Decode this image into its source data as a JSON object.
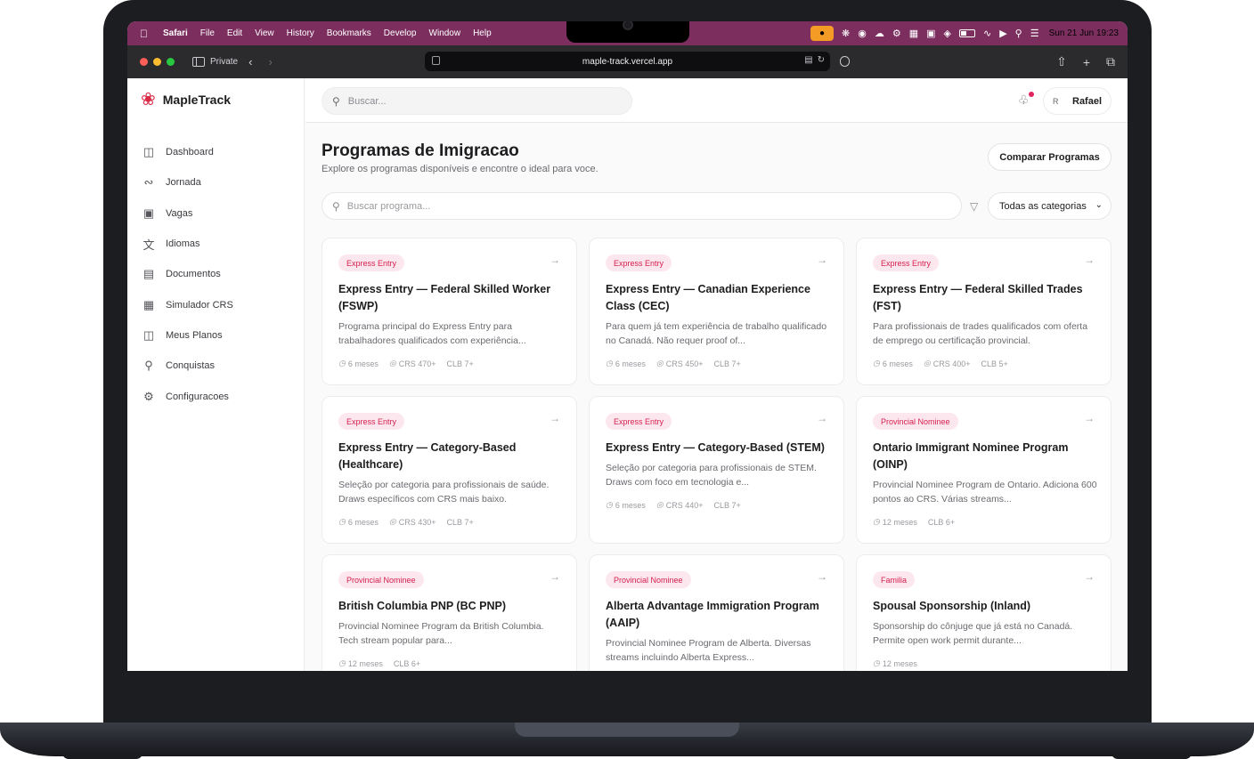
{
  "menubar": {
    "items": [
      "Safari",
      "File",
      "Edit",
      "View",
      "History",
      "Bookmarks",
      "Develop",
      "Window",
      "Help"
    ],
    "clock": "Sun 21 Jun  19:23"
  },
  "safari": {
    "private_label": "Private",
    "url": "maple-track.vercel.app"
  },
  "brand": {
    "name": "MapleTrack"
  },
  "sidebar": {
    "items": [
      {
        "label": "Dashboard",
        "icon": "dashboard-icon"
      },
      {
        "label": "Jornada",
        "icon": "route-icon"
      },
      {
        "label": "Vagas",
        "icon": "briefcase-icon"
      },
      {
        "label": "Idiomas",
        "icon": "translate-icon"
      },
      {
        "label": "Documentos",
        "icon": "document-icon"
      },
      {
        "label": "Simulador CRS",
        "icon": "calculator-icon"
      },
      {
        "label": "Meus Planos",
        "icon": "map-icon"
      },
      {
        "label": "Conquistas",
        "icon": "trophy-icon"
      },
      {
        "label": "Configuracoes",
        "icon": "settings-icon"
      }
    ]
  },
  "topbar": {
    "search_placeholder": "Buscar...",
    "avatar_initial": "R",
    "user_name": "Rafael"
  },
  "page": {
    "title": "Programas de Imigracao",
    "subtitle": "Explore os programas disponíveis e encontre o ideal para voce.",
    "compare_button": "Comparar Programas",
    "search_placeholder": "Buscar programa...",
    "category_select": "Todas as categorias"
  },
  "cards": [
    {
      "tag": "Express Entry",
      "title": "Express Entry — Federal Skilled Worker (FSWP)",
      "desc": "Programa principal do Express Entry para trabalhadores qualificados com experiência...",
      "time": "6 meses",
      "crs": "CRS 470+",
      "clb": "CLB 7+"
    },
    {
      "tag": "Express Entry",
      "title": "Express Entry — Canadian Experience Class (CEC)",
      "desc": "Para quem já tem experiência de trabalho qualificado no Canadá. Não requer proof of...",
      "time": "6 meses",
      "crs": "CRS 450+",
      "clb": "CLB 7+"
    },
    {
      "tag": "Express Entry",
      "title": "Express Entry — Federal Skilled Trades (FST)",
      "desc": "Para profissionais de trades qualificados com oferta de emprego ou certificação provincial.",
      "time": "6 meses",
      "crs": "CRS 400+",
      "clb": "CLB 5+"
    },
    {
      "tag": "Express Entry",
      "title": "Express Entry — Category-Based (Healthcare)",
      "desc": "Seleção por categoria para profissionais de saúde. Draws específicos com CRS mais baixo.",
      "time": "6 meses",
      "crs": "CRS 430+",
      "clb": "CLB 7+"
    },
    {
      "tag": "Express Entry",
      "title": "Express Entry — Category-Based (STEM)",
      "desc": "Seleção por categoria para profissionais de STEM. Draws com foco em tecnologia e...",
      "time": "6 meses",
      "crs": "CRS 440+",
      "clb": "CLB 7+"
    },
    {
      "tag": "Provincial Nominee",
      "title": "Ontario Immigrant Nominee Program (OINP)",
      "desc": "Provincial Nominee Program de Ontario. Adiciona 600 pontos ao CRS. Várias streams...",
      "time": "12 meses",
      "clb": "CLB 6+"
    },
    {
      "tag": "Provincial Nominee",
      "title": "British Columbia PNP (BC PNP)",
      "desc": "Provincial Nominee Program da British Columbia. Tech stream popular para...",
      "time": "12 meses",
      "clb": "CLB 6+"
    },
    {
      "tag": "Provincial Nominee",
      "title": "Alberta Advantage Immigration Program (AAIP)",
      "desc": "Provincial Nominee Program de Alberta. Diversas streams incluindo Alberta Express..."
    },
    {
      "tag": "Familia",
      "title": "Spousal Sponsorship (Inland)",
      "desc": "Sponsorship do cônjuge que já está no Canadá. Permite open work permit durante...",
      "time": "12 meses"
    }
  ],
  "colors": {
    "menubar": "#7c2f5f",
    "accent": "#d4204f",
    "tag_bg": "#fde7ee"
  }
}
